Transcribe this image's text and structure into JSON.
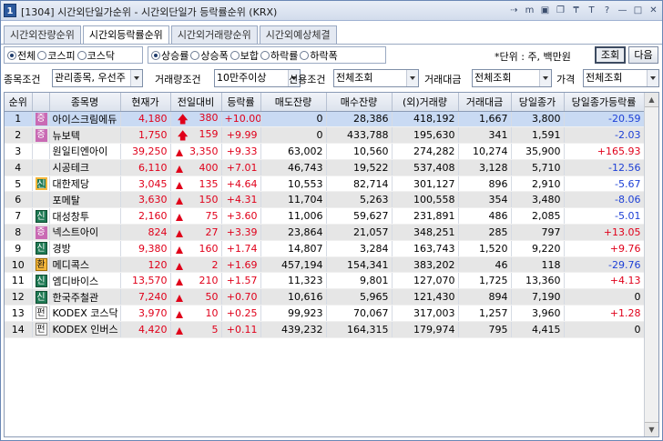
{
  "window": {
    "badge": "1",
    "title": "[1304] 시간외단일가순위 - 시간외단일가 등락률순위 (KRX)",
    "icons": [
      "link-icon",
      "memo-icon",
      "layout-icon",
      "window-icon",
      "pin-icon",
      "text-icon",
      "help-icon",
      "minimize-icon",
      "maximize-icon",
      "close-icon"
    ],
    "icon_glyphs": [
      "⇢",
      "m",
      "▣",
      "❐",
      "₸",
      "T",
      "?",
      "—",
      "□",
      "✕"
    ]
  },
  "tabs": [
    "시간외잔량순위",
    "시간외등락률순위",
    "시간외거래량순위",
    "시간외예상체결"
  ],
  "active_tab_index": 1,
  "market_filter": [
    {
      "label": "전체",
      "selected": true
    },
    {
      "label": "코스피",
      "selected": false
    },
    {
      "label": "코스닥",
      "selected": false
    }
  ],
  "rate_filter": [
    {
      "label": "상승률",
      "selected": true
    },
    {
      "label": "상승폭",
      "selected": false
    },
    {
      "label": "보합",
      "selected": false
    },
    {
      "label": "하락률",
      "selected": false
    },
    {
      "label": "하락폭",
      "selected": false
    }
  ],
  "unit_text": "*단위 : 주, 백만원",
  "buttons": {
    "query": "조회",
    "next": "다음"
  },
  "conditions": {
    "stock_cond_label": "종목조건",
    "stock_cond_value": "관리종목, 우선주",
    "volume_cond_label": "거래량조건",
    "volume_cond_value": "10만주이상",
    "credit_cond_label": "신용조건",
    "credit_cond_value": "전체조회",
    "amount_label": "거래대금",
    "amount_value": "전체조회",
    "price_label": "가격",
    "price_value": "전체조회"
  },
  "table": {
    "headers": [
      "순위",
      "",
      "종목명",
      "현재가",
      "전일대비",
      "등락률",
      "매도잔량",
      "매수잔량",
      "(외)거래량",
      "거래대금",
      "당일종가",
      "당일종가등락률"
    ],
    "rows": [
      {
        "rank": "1",
        "badge": "증",
        "badge_type": "pink",
        "name": "아이스크림에듀",
        "price": "4,180",
        "arrow": "limit",
        "change": "380",
        "rate": "+10.00",
        "ask": "0",
        "bid": "28,386",
        "volume": "418,192",
        "amount": "1,667",
        "close": "3,800",
        "close_rate": "-20.59",
        "close_rate_color": "blue",
        "price_color": "red",
        "selected": true
      },
      {
        "rank": "2",
        "badge": "증",
        "badge_type": "pink",
        "name": "뉴보텍",
        "price": "1,750",
        "arrow": "limit",
        "change": "159",
        "rate": "+9.99",
        "ask": "0",
        "bid": "433,788",
        "volume": "195,630",
        "amount": "341",
        "close": "1,591",
        "close_rate": "-2.03",
        "close_rate_color": "blue",
        "price_color": "red"
      },
      {
        "rank": "3",
        "badge": "",
        "badge_type": "none",
        "name": "원일티엔아이",
        "price": "39,250",
        "arrow": "up",
        "change": "3,350",
        "rate": "+9.33",
        "ask": "63,002",
        "bid": "10,560",
        "volume": "274,282",
        "amount": "10,274",
        "close": "35,900",
        "close_rate": "+165.93",
        "close_rate_color": "red",
        "price_color": "red"
      },
      {
        "rank": "4",
        "badge": "",
        "badge_type": "none",
        "name": "시공테크",
        "price": "6,110",
        "arrow": "up",
        "change": "400",
        "rate": "+7.01",
        "ask": "46,743",
        "bid": "19,522",
        "volume": "537,408",
        "amount": "3,128",
        "close": "5,710",
        "close_rate": "-12.56",
        "close_rate_color": "blue",
        "price_color": "red"
      },
      {
        "rank": "5",
        "badge": "신",
        "badge_type": "orange-green",
        "name": "대한제당",
        "price": "3,045",
        "arrow": "up",
        "change": "135",
        "rate": "+4.64",
        "ask": "10,553",
        "bid": "82,714",
        "volume": "301,127",
        "amount": "896",
        "close": "2,910",
        "close_rate": "-5.67",
        "close_rate_color": "blue",
        "price_color": "red"
      },
      {
        "rank": "6",
        "badge": "",
        "badge_type": "none",
        "name": "포메탈",
        "price": "3,630",
        "arrow": "up",
        "change": "150",
        "rate": "+4.31",
        "ask": "11,704",
        "bid": "5,263",
        "volume": "100,558",
        "amount": "354",
        "close": "3,480",
        "close_rate": "-8.06",
        "close_rate_color": "blue",
        "price_color": "red"
      },
      {
        "rank": "7",
        "badge": "신",
        "badge_type": "green",
        "name": "대성창투",
        "price": "2,160",
        "arrow": "up",
        "change": "75",
        "rate": "+3.60",
        "ask": "11,006",
        "bid": "59,627",
        "volume": "231,891",
        "amount": "486",
        "close": "2,085",
        "close_rate": "-5.01",
        "close_rate_color": "blue",
        "price_color": "red"
      },
      {
        "rank": "8",
        "badge": "증",
        "badge_type": "pink",
        "name": "넥스트아이",
        "price": "824",
        "arrow": "up",
        "change": "27",
        "rate": "+3.39",
        "ask": "23,864",
        "bid": "21,057",
        "volume": "348,251",
        "amount": "285",
        "close": "797",
        "close_rate": "+13.05",
        "close_rate_color": "red",
        "price_color": "red"
      },
      {
        "rank": "9",
        "badge": "신",
        "badge_type": "green",
        "name": "경방",
        "price": "9,380",
        "arrow": "up",
        "change": "160",
        "rate": "+1.74",
        "ask": "14,807",
        "bid": "3,284",
        "volume": "163,743",
        "amount": "1,520",
        "close": "9,220",
        "close_rate": "+9.76",
        "close_rate_color": "red",
        "price_color": "red"
      },
      {
        "rank": "10",
        "badge": "환",
        "badge_type": "orange",
        "name": "메디콕스",
        "price": "120",
        "arrow": "up",
        "change": "2",
        "rate": "+1.69",
        "ask": "457,194",
        "bid": "154,341",
        "volume": "383,202",
        "amount": "46",
        "close": "118",
        "close_rate": "-29.76",
        "close_rate_color": "blue",
        "price_color": "red"
      },
      {
        "rank": "11",
        "badge": "신",
        "badge_type": "green",
        "name": "엠디바이스",
        "price": "13,570",
        "arrow": "up",
        "change": "210",
        "rate": "+1.57",
        "ask": "11,323",
        "bid": "9,801",
        "volume": "127,070",
        "amount": "1,725",
        "close": "13,360",
        "close_rate": "+4.13",
        "close_rate_color": "red",
        "price_color": "red"
      },
      {
        "rank": "12",
        "badge": "신",
        "badge_type": "green",
        "name": "한국주철관",
        "price": "7,240",
        "arrow": "up",
        "change": "50",
        "rate": "+0.70",
        "ask": "10,616",
        "bid": "5,965",
        "volume": "121,430",
        "amount": "894",
        "close": "7,190",
        "close_rate": "0",
        "close_rate_color": "black",
        "price_color": "red"
      },
      {
        "rank": "13",
        "badge": "펀",
        "badge_type": "white",
        "name": "KODEX 코스닥",
        "price": "3,970",
        "arrow": "up",
        "change": "10",
        "rate": "+0.25",
        "ask": "99,923",
        "bid": "70,067",
        "volume": "317,003",
        "amount": "1,257",
        "close": "3,960",
        "close_rate": "+1.28",
        "close_rate_color": "red",
        "price_color": "red"
      },
      {
        "rank": "14",
        "badge": "펀",
        "badge_type": "white",
        "name": "KODEX 인버스",
        "price": "4,420",
        "arrow": "up",
        "change": "5",
        "rate": "+0.11",
        "ask": "439,232",
        "bid": "164,315",
        "volume": "179,974",
        "amount": "795",
        "close": "4,415",
        "close_rate": "0",
        "close_rate_color": "black",
        "price_color": "red"
      }
    ]
  }
}
